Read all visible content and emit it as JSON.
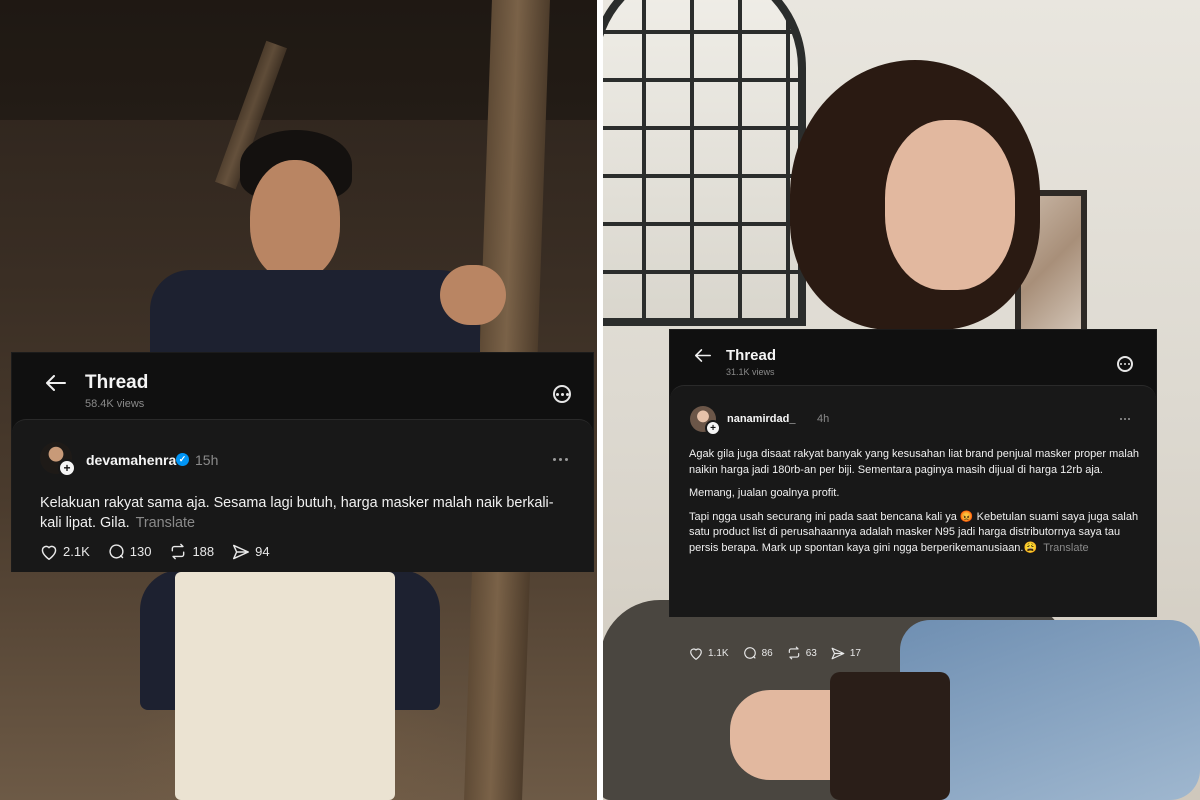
{
  "left_thread": {
    "header": {
      "title": "Thread",
      "views": "58.4K views",
      "back_icon": "arrow-left-icon",
      "more_icon": "more-circle-icon"
    },
    "post": {
      "username": "devamahenra",
      "verified": true,
      "time_ago": "15h",
      "text": "Kelakuan rakyat sama aja. Sesama lagi butuh, harga masker malah naik berkali-kali lipat. Gila.",
      "translate_label": "Translate",
      "likes": "2.1K",
      "replies": "130",
      "reposts": "188",
      "shares": "94"
    }
  },
  "right_thread": {
    "header": {
      "title": "Thread",
      "views": "31.1K views",
      "back_icon": "arrow-left-icon",
      "more_icon": "more-circle-icon"
    },
    "post": {
      "username": "nanamirdad_",
      "verified": false,
      "time_ago": "4h",
      "paragraph_1": "Agak gila juga disaat rakyat banyak yang kesusahan liat brand penjual masker proper malah naikin harga jadi 180rb-an per biji. Sementara paginya masih dijual di harga 12rb aja.",
      "paragraph_2": "Memang, jualan goalnya profit.",
      "paragraph_3": "Tapi ngga usah securang ini pada saat bencana kali ya 😡 Kebetulan suami saya juga salah satu product list di perusahaannya adalah masker N95 jadi harga distributornya saya tau persis berapa. Mark up spontan kaya gini ngga berperikemanusiaan.😩",
      "translate_label": "Translate",
      "likes": "1.1K",
      "replies": "86",
      "reposts": "63",
      "shares": "17"
    }
  },
  "colors": {
    "card_bg": "#101010",
    "post_bg": "#181818",
    "muted_text": "#8a8a8a",
    "verified_blue": "#0095f6"
  }
}
